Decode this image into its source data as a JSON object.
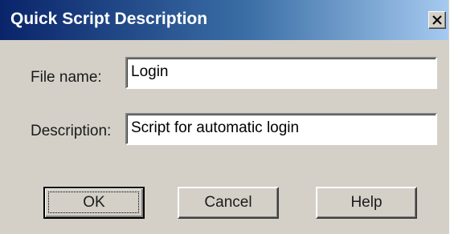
{
  "window": {
    "title": "Quick Script Description",
    "close_icon": "close-icon"
  },
  "form": {
    "file_name_label": "File name:",
    "file_name_value": "Login",
    "description_label": "Description:",
    "description_value": "Script for automatic login"
  },
  "buttons": {
    "ok_label": "OK",
    "cancel_label": "Cancel",
    "help_label": "Help"
  },
  "colors": {
    "title_gradient_start": "#0a246a",
    "title_gradient_end": "#a6caf0",
    "dialog_background": "#d4d0c8"
  }
}
